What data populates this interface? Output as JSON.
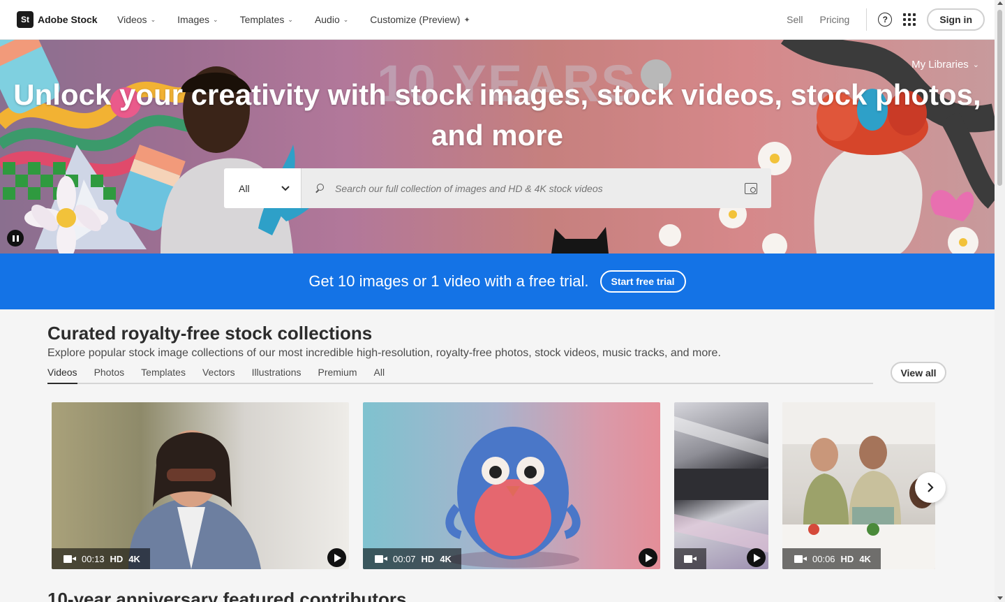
{
  "brand": {
    "mark": "St",
    "name": "Adobe Stock"
  },
  "nav": [
    {
      "label": "Videos",
      "icon": "chevron-down-icon"
    },
    {
      "label": "Images",
      "icon": "chevron-down-icon"
    },
    {
      "label": "Templates",
      "icon": "chevron-down-icon"
    },
    {
      "label": "Audio",
      "icon": "chevron-down-icon"
    },
    {
      "label": "Customize (Preview)",
      "icon": "sparkle-icon"
    }
  ],
  "right_nav": {
    "sell": "Sell",
    "pricing": "Pricing",
    "help_glyph": "?",
    "sign_in": "Sign in"
  },
  "hero": {
    "background_text": "10 YEARS",
    "title": "Unlock your creativity with stock images, stock videos, stock photos, and more",
    "my_libraries": "My Libraries",
    "search": {
      "category": "All",
      "placeholder": "Search our full collection of images and HD & 4K stock videos"
    }
  },
  "promo": {
    "text": "Get 10 images or 1 video with a free trial.",
    "button": "Start free trial",
    "color": "#1473e6"
  },
  "collections": {
    "title": "Curated royalty-free stock collections",
    "subtitle": "Explore popular stock image collections of our most incredible high-resolution, royalty-free photos, stock videos, music tracks, and more.",
    "tabs": [
      "Videos",
      "Photos",
      "Templates",
      "Vectors",
      "Illustrations",
      "Premium",
      "All"
    ],
    "active_tab": "Videos",
    "view_all": "View all",
    "cards": [
      {
        "duration": "00:13",
        "hd": "HD",
        "uhd": "4K"
      },
      {
        "duration": "00:07",
        "hd": "HD",
        "uhd": "4K"
      },
      {
        "duration": "",
        "hd": "",
        "uhd": ""
      },
      {
        "duration": "00:06",
        "hd": "HD",
        "uhd": "4K"
      }
    ]
  },
  "next_section": {
    "title": "10-year anniversary featured contributors"
  }
}
